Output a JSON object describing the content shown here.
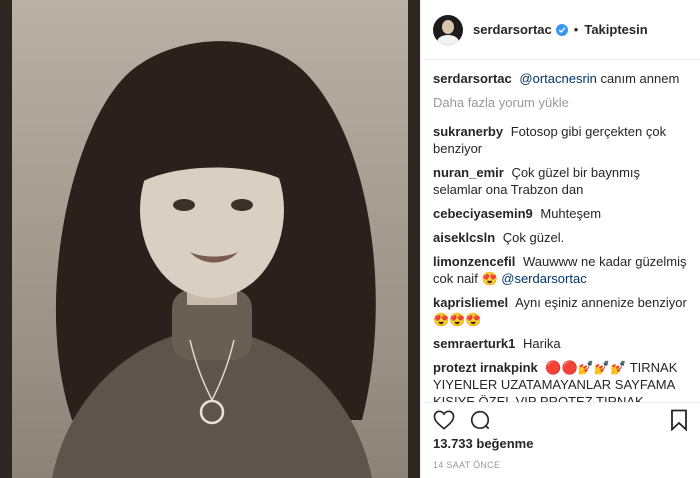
{
  "post": {
    "username": "serdarsortac",
    "follow_status": "Takiptesin",
    "likes": "13.733 beğenme",
    "timestamp": "14 SAAT ÖNCE",
    "load_more": "Daha fazla yorum yükle"
  },
  "caption": {
    "user": "serdarsortac",
    "mention": "@ortacnesrin",
    "text": "canım annem"
  },
  "comments": [
    {
      "user": "sukranerby",
      "text": "Fotosop gibi gerçekten çok benziyor"
    },
    {
      "user": "nuran_emir",
      "text": "Çok güzel bir baynmış selamlar ona Trabzon dan"
    },
    {
      "user": "cebeciyasemin9",
      "text": "Muhteşem"
    },
    {
      "user": "aiseklcsln",
      "text": "Çok güzel."
    },
    {
      "user": "limonzencefil",
      "text": "Wauwww ne kadar güzelmiş cok naif",
      "emoji": "😍",
      "mention": "@serdarsortac"
    },
    {
      "user": "kaprisliemel",
      "text": "Aynı eşiniz annenize benziyor",
      "emoji": "😍😍😍"
    },
    {
      "user": "semraerturk1",
      "text": "Harika"
    },
    {
      "user": "protezt irnakpink",
      "text": "TIRNAK YIYENLER UZATAMAYANLAR SAYFAMA KISIYE ÖZEL VIP PROTEZ TIRNAK HIZMETI SAYFAMA",
      "emoji_before": "🔴🔴💅💅💅",
      "emoji_after": "💅💅💅🔴🔴"
    }
  ],
  "icons": {
    "verified": "verified-badge-icon",
    "like": "heart-icon",
    "comment": "comment-icon",
    "save": "bookmark-icon"
  },
  "colors": {
    "verified": "#3897f0",
    "mention": "#003569",
    "muted": "#999999"
  }
}
